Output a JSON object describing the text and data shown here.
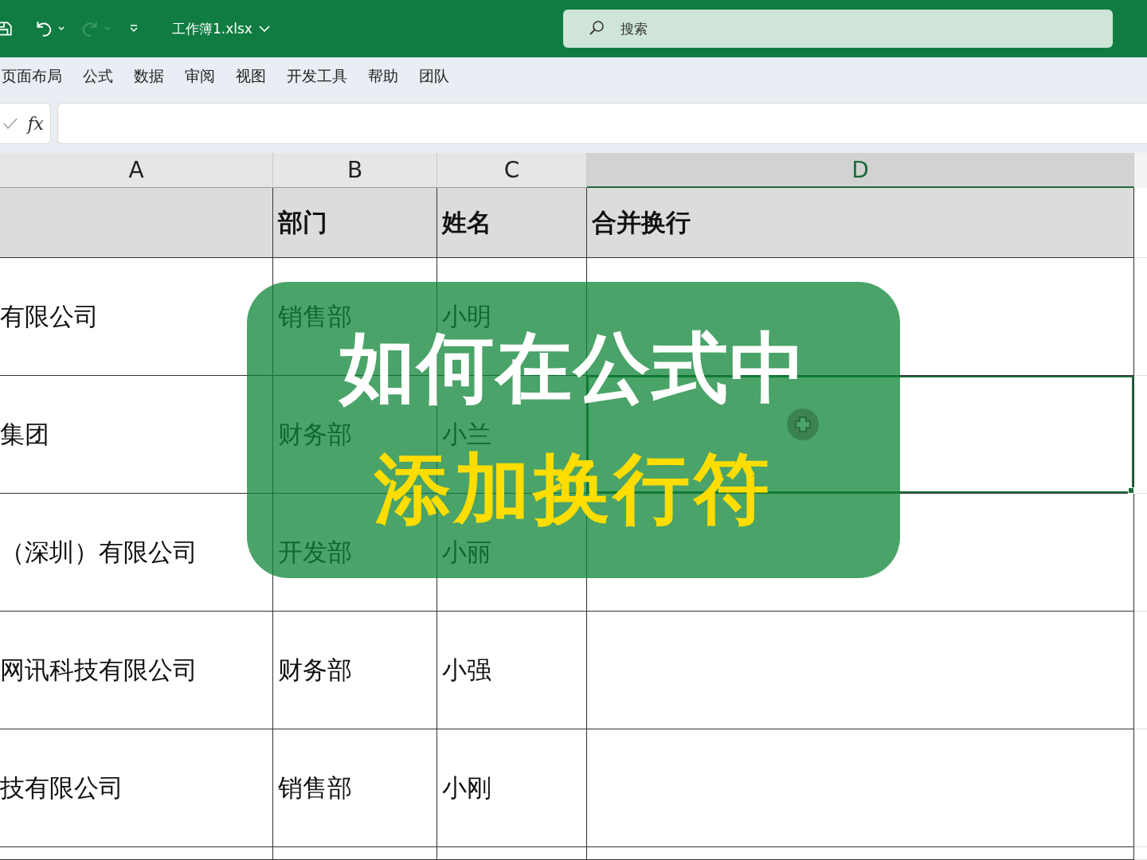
{
  "title_bar": {
    "file_name": "工作簿1.xlsx",
    "redo_disabled": true,
    "search": {
      "placeholder": "搜索"
    }
  },
  "ribbon_tabs": [
    "页面布局",
    "公式",
    "数据",
    "审阅",
    "视图",
    "开发工具",
    "帮助",
    "团队"
  ],
  "formula_bar": {
    "fx_label": "fx"
  },
  "columns": [
    {
      "label": "A",
      "selected": false
    },
    {
      "label": "B",
      "selected": false
    },
    {
      "label": "C",
      "selected": false
    },
    {
      "label": "D",
      "selected": true
    }
  ],
  "header_row": {
    "department": "部门",
    "name": "姓名",
    "merged": "合并换行"
  },
  "rows": [
    {
      "company": "有限公司",
      "department": "销售部",
      "name": "小明",
      "selected": false
    },
    {
      "company": "集团",
      "department": "财务部",
      "name": "小兰",
      "selected": true
    },
    {
      "company": "（深圳）有限公司",
      "department": "开发部",
      "name": "小丽",
      "selected": false
    },
    {
      "company": "网讯科技有限公司",
      "department": "财务部",
      "name": "小强",
      "selected": false
    },
    {
      "company": "技有限公司",
      "department": "销售部",
      "name": "小刚",
      "selected": false
    }
  ],
  "overlay": {
    "title_line_1": "如何在公式中",
    "title_line_2": "添加换行符"
  }
}
